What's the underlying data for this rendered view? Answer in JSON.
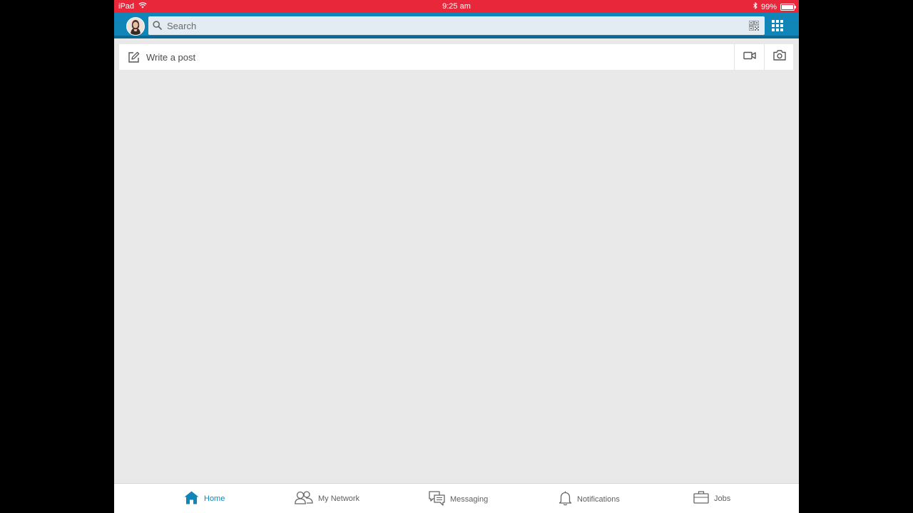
{
  "status_bar": {
    "device": "iPad",
    "time": "9:25 am",
    "battery": "99%",
    "battery_fill": 0.99
  },
  "header": {
    "search": {
      "placeholder": "Search"
    }
  },
  "composer": {
    "label": "Write a post"
  },
  "tabs": [
    {
      "label": "Home",
      "icon": "home-icon",
      "active": true
    },
    {
      "label": "My Network",
      "icon": "network-icon",
      "active": false
    },
    {
      "label": "Messaging",
      "icon": "messaging-icon",
      "active": false
    },
    {
      "label": "Notifications",
      "icon": "bell-icon",
      "active": false
    },
    {
      "label": "Jobs",
      "icon": "briefcase-icon",
      "active": false
    }
  ],
  "colors": {
    "status_bar": "#e8283a",
    "header": "#0f86b7",
    "background": "#e9e9e9",
    "active_tab": "#0f86b7"
  }
}
